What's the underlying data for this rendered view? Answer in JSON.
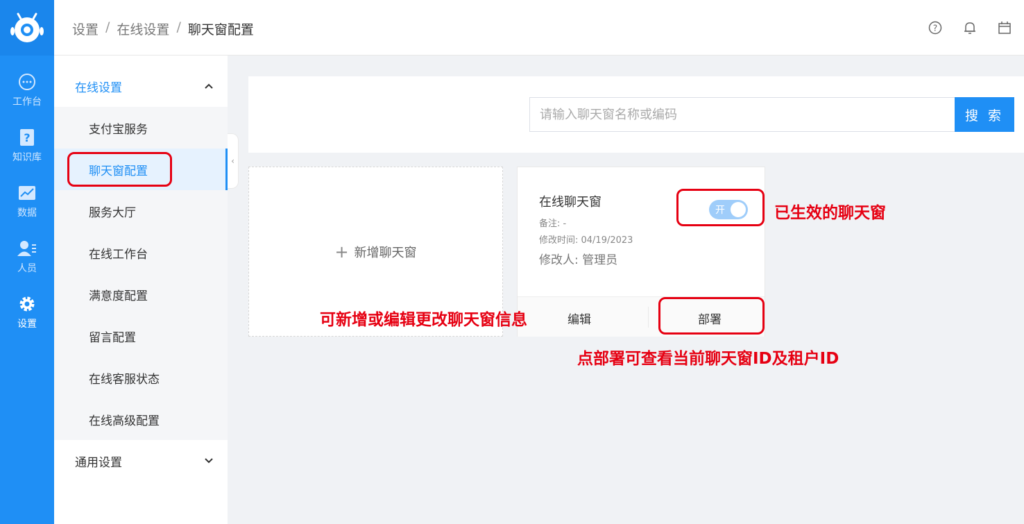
{
  "header": {
    "breadcrumb": [
      "设置",
      "在线设置",
      "聊天窗配置"
    ],
    "separator": "/"
  },
  "rail": {
    "items": [
      {
        "label": "工作台",
        "icon": "chat-bubble-icon"
      },
      {
        "label": "知识库",
        "icon": "question-book-icon"
      },
      {
        "label": "数据",
        "icon": "chart-icon"
      },
      {
        "label": "人员",
        "icon": "person-list-icon"
      },
      {
        "label": "设置",
        "icon": "gear-icon"
      }
    ],
    "active": "设置"
  },
  "subnav": {
    "group1_title": "在线设置",
    "items": [
      "支付宝服务",
      "聊天窗配置",
      "服务大厅",
      "在线工作台",
      "满意度配置",
      "留言配置",
      "在线客服状态",
      "在线高级配置"
    ],
    "active": "聊天窗配置",
    "group2_title": "通用设置"
  },
  "search": {
    "placeholder": "请输入聊天窗名称或编码",
    "button_label": "搜 索"
  },
  "add_card": {
    "plus": "+",
    "label": "新增聊天窗"
  },
  "chat_card": {
    "title": "在线聊天窗",
    "remark": "备注: -",
    "modified_time": "修改时间: 04/19/2023",
    "modifier": "修改人: 管理员",
    "toggle_label": "开",
    "toggle_on": true,
    "edit_label": "编辑",
    "deploy_label": "部署"
  },
  "annotations": {
    "active_note": "已生效的聊天窗",
    "edit_note": "可新增或编辑更改聊天窗信息",
    "deploy_note": "点部署可查看当前聊天窗ID及租户ID"
  },
  "colors": {
    "primary": "#1f8ff5",
    "annotation": "#e60012"
  }
}
